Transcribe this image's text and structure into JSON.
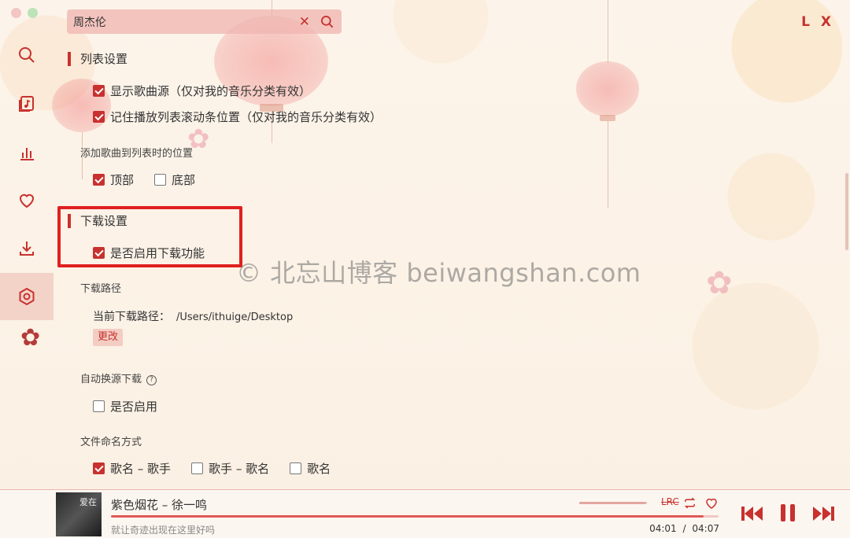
{
  "app": {
    "brand": "L X"
  },
  "search": {
    "value": "周杰伦"
  },
  "sidebar": {
    "items": [
      {
        "name": "search-icon"
      },
      {
        "name": "song-list-icon"
      },
      {
        "name": "leaderboard-icon"
      },
      {
        "name": "heart-icon"
      },
      {
        "name": "download-icon"
      },
      {
        "name": "settings-icon",
        "active": true
      }
    ]
  },
  "settings": {
    "list_section": {
      "title": "列表设置",
      "show_source": "显示歌曲源（仅对我的音乐分类有效）",
      "remember_scroll": "记住播放列表滚动条位置（仅对我的音乐分类有效）",
      "add_position_title": "添加歌曲到列表时的位置",
      "top": "顶部",
      "bottom": "底部"
    },
    "download_section": {
      "title": "下载设置",
      "enable": "是否启用下载功能",
      "path_title": "下载路径",
      "current_path_label": "当前下载路径：",
      "current_path_value": "/Users/ithuige/Desktop",
      "change_button": "更改",
      "auto_switch_title": "自动换源下载",
      "auto_switch_enable": "是否启用",
      "help_icon": "?",
      "naming_title": "文件命名方式",
      "naming_opt1": "歌名 – 歌手",
      "naming_opt2": "歌手 – 歌名",
      "naming_opt3": "歌名"
    }
  },
  "watermark": "© 北忘山博客 beiwangshan.com",
  "player": {
    "song": "紫色烟花 – 徐一鸣",
    "lyric": "就让奇迹出现在这里好吗",
    "current_time": "04:01",
    "separator": "/",
    "total_time": "04:07",
    "progress": 0.976,
    "volume": 0.98,
    "cover_text": "爱在",
    "lrc_label": "LRC"
  },
  "colors": {
    "accent": "#c8312e",
    "highlight_box": "#e02020"
  }
}
